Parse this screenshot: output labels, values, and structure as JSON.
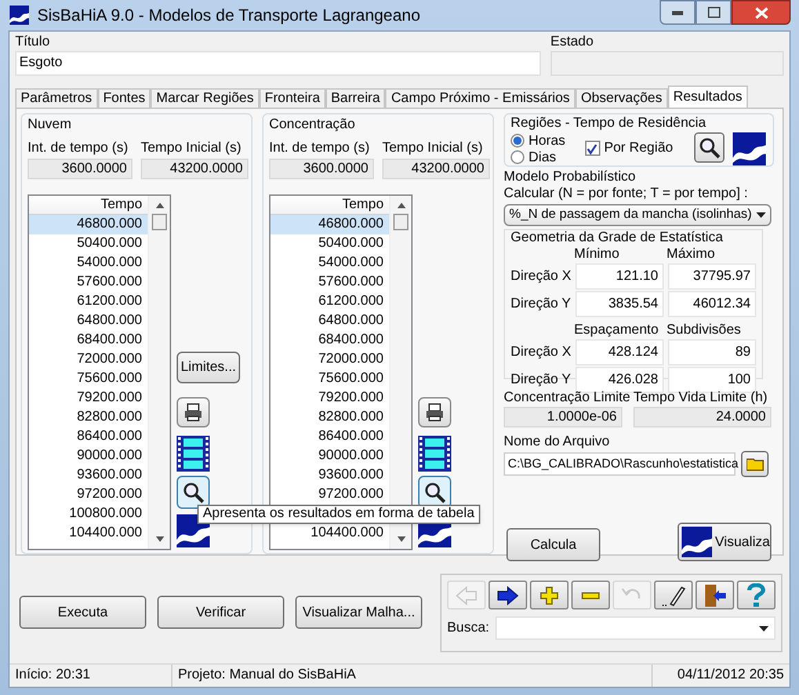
{
  "window": {
    "title": "SisBaHiA 9.0 - Modelos de Transporte Lagrangeano"
  },
  "header": {
    "title_label": "Título",
    "title_value": "Esgoto",
    "state_label": "Estado"
  },
  "tabs": [
    {
      "label": "Parâmetros",
      "selected": false
    },
    {
      "label": "Fontes",
      "selected": false
    },
    {
      "label": "Marcar Regiões",
      "selected": false
    },
    {
      "label": "Fronteira",
      "selected": false
    },
    {
      "label": "Barreira",
      "selected": false
    },
    {
      "label": "Campo Próximo - Emissários",
      "selected": false
    },
    {
      "label": "Observações",
      "selected": false
    },
    {
      "label": "Resultados",
      "selected": true
    }
  ],
  "groups": [
    {
      "title": "Nuvem",
      "interval_label": "Int. de tempo (s)",
      "interval_value": "3600.0000",
      "start_label": "Tempo Inicial (s)",
      "start_value": "43200.0000",
      "list_header": "Tempo",
      "limits_button": "Limites...",
      "rows": [
        {
          "text": "46800.000",
          "selected": true
        },
        {
          "text": "50400.000",
          "selected": false
        },
        {
          "text": "54000.000",
          "selected": false
        },
        {
          "text": "57600.000",
          "selected": false
        },
        {
          "text": "61200.000",
          "selected": false
        },
        {
          "text": "64800.000",
          "selected": false
        },
        {
          "text": "68400.000",
          "selected": false
        },
        {
          "text": "72000.000",
          "selected": false
        },
        {
          "text": "75600.000",
          "selected": false
        },
        {
          "text": "79200.000",
          "selected": false
        },
        {
          "text": "82800.000",
          "selected": false
        },
        {
          "text": "86400.000",
          "selected": false
        },
        {
          "text": "90000.000",
          "selected": false
        },
        {
          "text": "93600.000",
          "selected": false
        },
        {
          "text": "97200.000",
          "selected": false
        },
        {
          "text": "100800.000",
          "selected": false
        },
        {
          "text": "104400.000",
          "selected": false
        }
      ]
    },
    {
      "title": "Concentração",
      "interval_label": "Int. de tempo (s)",
      "interval_value": "3600.0000",
      "start_label": "Tempo Inicial (s)",
      "start_value": "43200.0000",
      "list_header": "Tempo",
      "rows": [
        {
          "text": "46800.000",
          "selected": true
        },
        {
          "text": "50400.000",
          "selected": false
        },
        {
          "text": "54000.000",
          "selected": false
        },
        {
          "text": "57600.000",
          "selected": false
        },
        {
          "text": "61200.000",
          "selected": false
        },
        {
          "text": "64800.000",
          "selected": false
        },
        {
          "text": "68400.000",
          "selected": false
        },
        {
          "text": "72000.000",
          "selected": false
        },
        {
          "text": "75600.000",
          "selected": false
        },
        {
          "text": "79200.000",
          "selected": false
        },
        {
          "text": "82800.000",
          "selected": false
        },
        {
          "text": "86400.000",
          "selected": false
        },
        {
          "text": "90000.000",
          "selected": false
        },
        {
          "text": "93600.000",
          "selected": false
        },
        {
          "text": "97200.000",
          "selected": false
        },
        {
          "obscured": true
        },
        {
          "text": "104400.000",
          "selected": false
        }
      ]
    }
  ],
  "tooltip": "Apresenta os resultados em forma de tabela",
  "residence": {
    "title": "Regiões - Tempo de Residência",
    "radios": [
      {
        "label": "Horas",
        "selected": true
      },
      {
        "label": "Dias",
        "selected": false
      }
    ],
    "per_region": {
      "label": "Por Região",
      "checked": true
    }
  },
  "probabilistic": {
    "title": "Modelo Probabilístico",
    "calc_label": "Calcular (N = por fonte; T = por tempo] :",
    "calc_value": "%_N de passagem da mancha (isolinhas)",
    "grid": {
      "title": "Geometria da Grade de Estatística",
      "head1": [
        "Mínimo",
        "Máximo"
      ],
      "rows1": [
        {
          "label": "Direção X",
          "values": [
            "121.10",
            "37795.97"
          ]
        },
        {
          "label": "Direção Y",
          "values": [
            "3835.54",
            "46012.34"
          ]
        }
      ],
      "head2": [
        "Espaçamento",
        "Subdivisões"
      ],
      "rows2": [
        {
          "label": "Direção X",
          "values": [
            "428.124",
            "89"
          ]
        },
        {
          "label": "Direção Y",
          "values": [
            "426.028",
            "100"
          ]
        }
      ]
    },
    "conc_limit_label": "Concentração Limite",
    "conc_limit_value": "1.0000e-06",
    "life_limit_label": "Tempo Vida Limite (h)",
    "life_limit_value": "24.0000",
    "file_label": "Nome do Arquivo",
    "file_value": "C:\\BG_CALIBRADO\\Rascunho\\estatistica",
    "calc_button": "Calcula",
    "view_button": "Visualiza"
  },
  "buttons": [
    "Executa",
    "Verificar",
    "Visualizar Malha..."
  ],
  "toolbar": [
    {
      "kind": "back",
      "disabled": true
    },
    {
      "kind": "forward",
      "disabled": false
    },
    {
      "kind": "add",
      "disabled": false
    },
    {
      "kind": "remove",
      "disabled": false
    },
    {
      "kind": "undo",
      "disabled": true
    },
    {
      "kind": "edit",
      "disabled": false
    },
    {
      "kind": "exit",
      "disabled": false
    },
    {
      "kind": "help",
      "disabled": false
    }
  ],
  "search": {
    "label": "Busca:"
  },
  "status_bar": [
    "Início: 20:31",
    "Projeto: Manual do SisBaHiA",
    "04/11/2012 20:35"
  ]
}
